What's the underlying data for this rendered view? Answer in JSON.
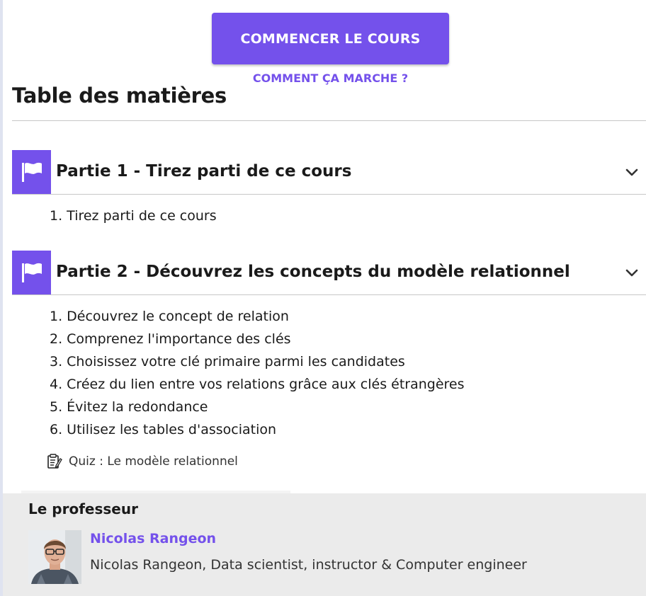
{
  "cta": {
    "start_label": "COMMENCER LE COURS",
    "how_label": "COMMENT ÇA MARCHE ?"
  },
  "toc": {
    "title": "Table des matières",
    "parts": [
      {
        "title": "Partie 1 - Tirez parti de ce cours",
        "icon": "flag-icon",
        "chapters": [
          "1. Tirez parti de ce cours"
        ]
      },
      {
        "title": "Partie 2 - Découvrez les concepts du modèle relationnel",
        "icon": "flag-icon",
        "chapters": [
          "1. Découvrez le concept de relation",
          "2. Comprenez l'importance des clés",
          "3. Choisissez votre clé primaire parmi les candidates",
          "4. Créez du lien entre vos relations grâce aux clés étrangères",
          "5. Évitez la redondance",
          "6. Utilisez les tables d'association"
        ],
        "quiz": "Quiz : Le modèle relationnel"
      }
    ]
  },
  "teacher": {
    "title": "Le professeur",
    "name": "Nicolas Rangeon",
    "bio": "Nicolas Rangeon, Data scientist, instructor & Computer engineer"
  },
  "colors": {
    "accent": "#7451eb",
    "panel_background": "#ebebeb",
    "text": "#1a1a1a"
  }
}
